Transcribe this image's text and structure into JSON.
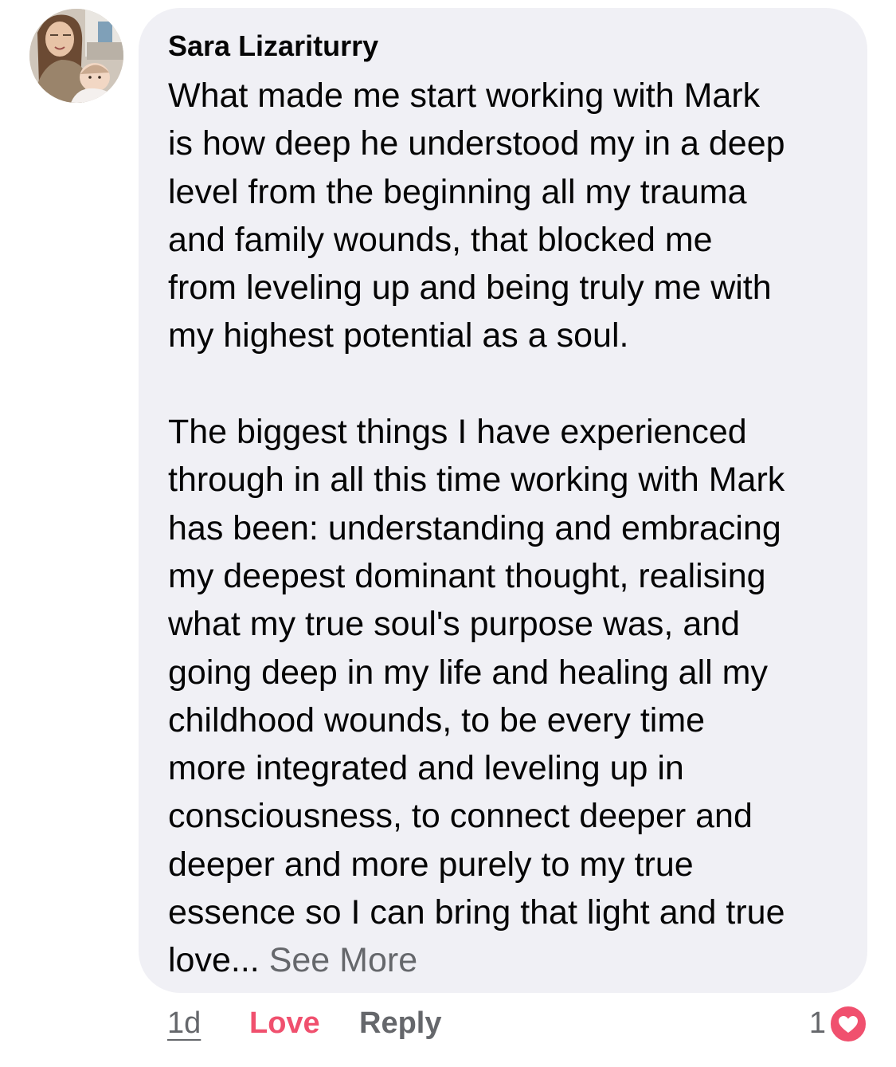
{
  "comment": {
    "author": "Sara Lizariturry",
    "avatar_icon": "profile-photo",
    "paragraph1": [
      "What made me start working with Mark",
      "is how deep he understood my in a deep",
      "level from the beginning all my trauma",
      "and family wounds, that blocked me",
      "from leveling up and being truly me with",
      "my highest potential as a soul."
    ],
    "paragraph2": [
      "The biggest things I have experienced",
      "through in all this time working with Mark",
      "has been: understanding and embracing",
      "my deepest dominant thought, realising",
      "what my true soul's purpose was, and",
      "going deep in my life and healing all my",
      "childhood wounds, to be every time",
      "more integrated and leveling up in",
      "consciousness, to connect deeper and",
      "deeper and more purely to my true",
      "essence so I can bring that light and true"
    ],
    "last_line": "love...",
    "see_more": "See More",
    "bubble_color": "#f0f0f5"
  },
  "actions": {
    "timestamp": "1d",
    "love": "Love",
    "reply": "Reply",
    "reaction_count": "1",
    "reaction_icon": "heart-icon",
    "love_color": "#f0506e",
    "muted_color": "#65676b"
  }
}
